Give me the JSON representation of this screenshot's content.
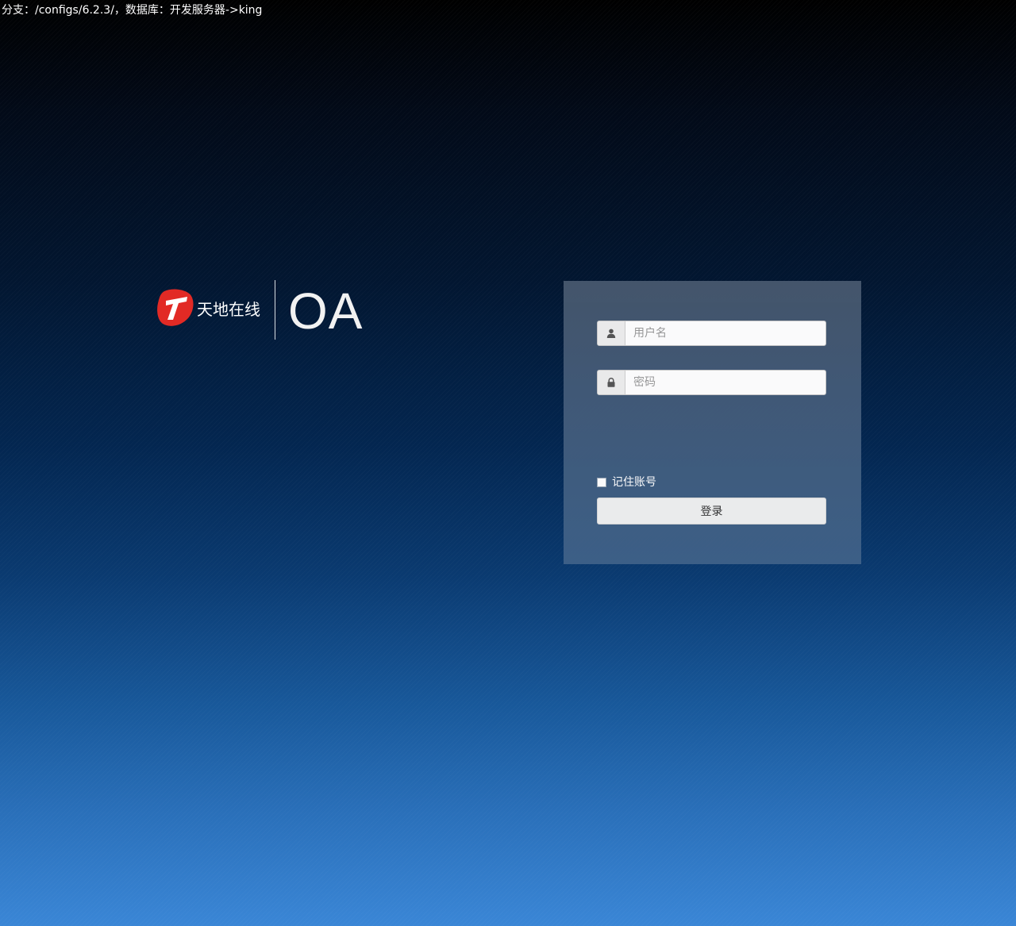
{
  "env": {
    "text": "分支：/configs/6.2.3/，数据库：开发服务器->king"
  },
  "brand": {
    "logo_icon": "tiandi-logo-icon",
    "name": "天地在线",
    "product": "OA",
    "logo_color": "#e22a25"
  },
  "login": {
    "username": {
      "icon": "user-icon",
      "placeholder": "用户名",
      "value": ""
    },
    "password": {
      "icon": "lock-icon",
      "placeholder": "密码",
      "value": ""
    },
    "remember": {
      "label": "记住账号",
      "checked": false
    },
    "submit_label": "登录"
  }
}
